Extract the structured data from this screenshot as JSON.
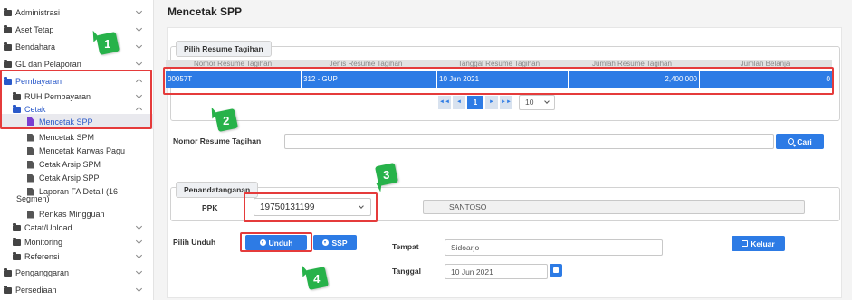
{
  "sidebar": {
    "items": [
      {
        "label": "Administrasi"
      },
      {
        "label": "Aset Tetap"
      },
      {
        "label": "Bendahara"
      },
      {
        "label": "GL dan Pelaporan"
      },
      {
        "label": "Pembayaran"
      },
      {
        "label": "RUH Pembayaran"
      },
      {
        "label": "Cetak"
      },
      {
        "label": "Mencetak SPP"
      },
      {
        "label": "Mencetak SPM"
      },
      {
        "label": "Mencetak Karwas Pagu"
      },
      {
        "label": "Cetak Arsip SPM"
      },
      {
        "label": "Cetak Arsip SPP"
      },
      {
        "label": "Laporan FA Detail (16"
      },
      {
        "label": "Segmen)"
      },
      {
        "label": "Renkas Mingguan"
      },
      {
        "label": "Catat/Upload"
      },
      {
        "label": "Monitoring"
      },
      {
        "label": "Referensi"
      },
      {
        "label": "Penganggaran"
      },
      {
        "label": "Persediaan"
      }
    ]
  },
  "main": {
    "title": "Mencetak SPP",
    "resume_section": {
      "legend": "Pilih Resume Tagihan",
      "columns": [
        "Nomor Resume Tagihan",
        "Jenis Resume Tagihan",
        "Tanggal Resume Tagihan",
        "Jumlah Resume Tagihan",
        "Jumlah Belanja"
      ],
      "rows": [
        {
          "nomor": "00057T",
          "jenis": "312 - GUP",
          "tanggal": "10 Jun 2021",
          "jumlah": "2,400,000",
          "belanja": "0"
        }
      ],
      "pager": {
        "first": "◄◄",
        "prev": "◄",
        "page": "1",
        "next": "►",
        "last": "►►",
        "page_size": "10"
      }
    },
    "search": {
      "label": "Nomor Resume Tagihan",
      "value": "",
      "button": "Cari"
    },
    "signer_section": {
      "legend": "Penandatanganan",
      "ppk_label": "PPK",
      "ppk_value": "19750131199",
      "ppk_name": "SANTOSO"
    },
    "download": {
      "label": "Pilih Unduh",
      "unduh_button": "Unduh",
      "ssp_button": "SSP"
    },
    "tempat": {
      "label": "Tempat",
      "value": "Sidoarjo"
    },
    "tanggal": {
      "label": "Tanggal",
      "value": "10 Jun 2021"
    },
    "keluar_button": "Keluar"
  },
  "annotations": [
    "1",
    "2",
    "3",
    "4"
  ],
  "colors": {
    "accent": "#2d7be5",
    "highlight": "#e53b3b",
    "badge": "#27b24a"
  }
}
